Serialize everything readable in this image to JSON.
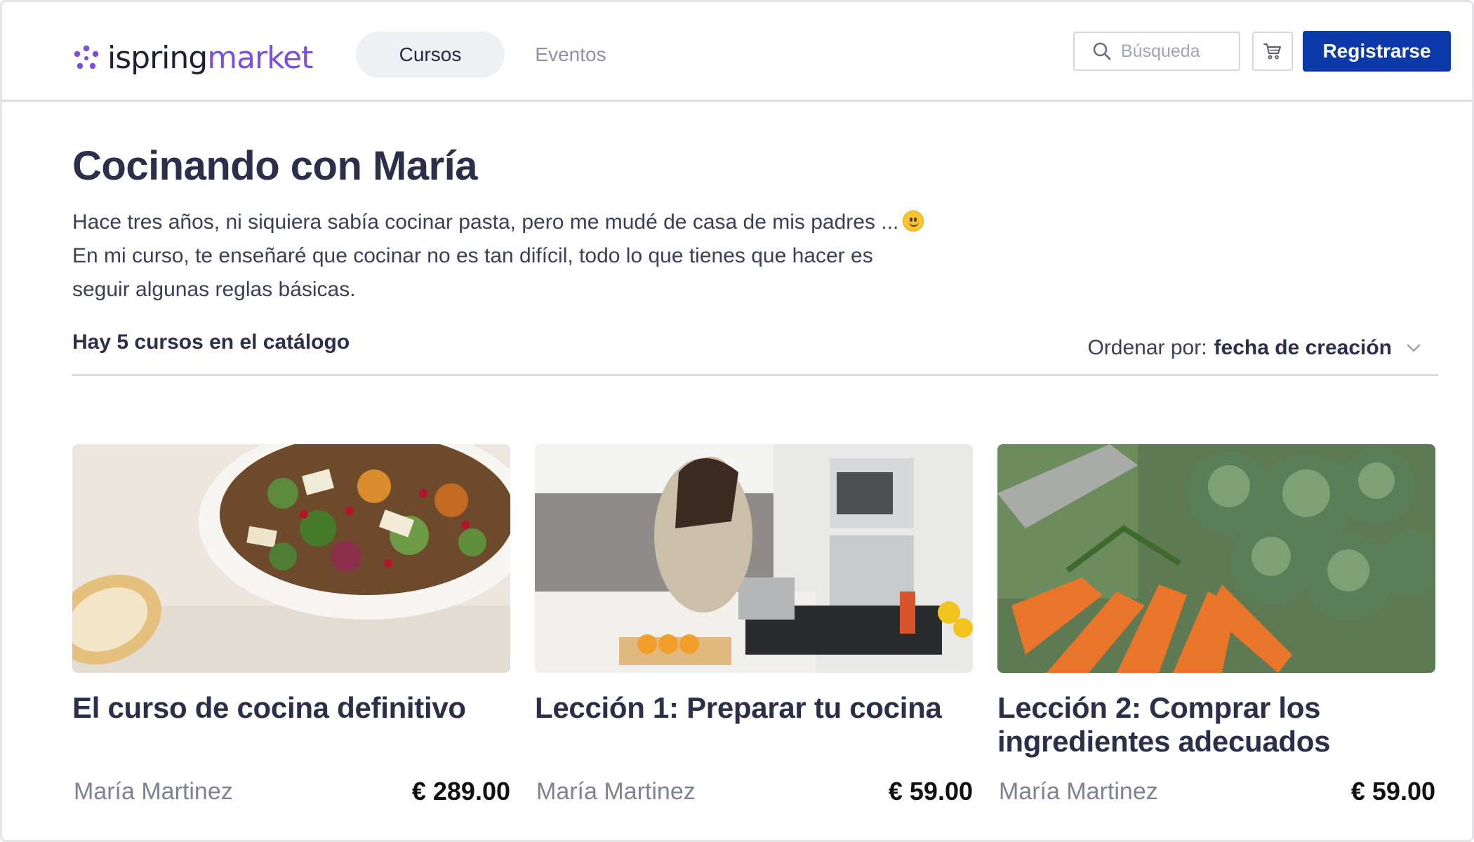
{
  "header": {
    "logo": {
      "part1": "ispring",
      "part2": "market"
    },
    "tabs": [
      {
        "label": "Cursos",
        "active": true
      },
      {
        "label": "Eventos",
        "active": false
      }
    ],
    "search": {
      "placeholder": "Búsqueda"
    },
    "cart_icon": "cart-icon",
    "signup_label": "Registrarse"
  },
  "main": {
    "title": "Cocinando con María",
    "description": [
      "Hace tres años, ni siquiera sabía cocinar pasta, pero me mudé de casa de mis padres ...",
      "En mi curso, te enseñaré que cocinar no es tan difícil, todo lo que tienes que hacer es",
      "seguir algunas reglas básicas."
    ],
    "catalog_count": "Hay 5 cursos en el catálogo",
    "sort": {
      "label": "Ordenar por:",
      "value": "fecha de creación"
    }
  },
  "courses": [
    {
      "title": "El curso de cocina definitivo",
      "author": "María Martinez",
      "price": "€ 289.00",
      "image": "salad-photo"
    },
    {
      "title": "Lección 1: Preparar tu cocina",
      "author": "María Martinez",
      "price": "€ 59.00",
      "image": "kitchen-photo"
    },
    {
      "title": "Lección 2: Comprar los ingredientes adecuados",
      "author": "María Martinez",
      "price": "€ 59.00",
      "image": "vegetables-photo"
    }
  ],
  "colors": {
    "accent": "#7a4fe0",
    "button": "#0b3aa8",
    "text": "#2b2f4a"
  }
}
